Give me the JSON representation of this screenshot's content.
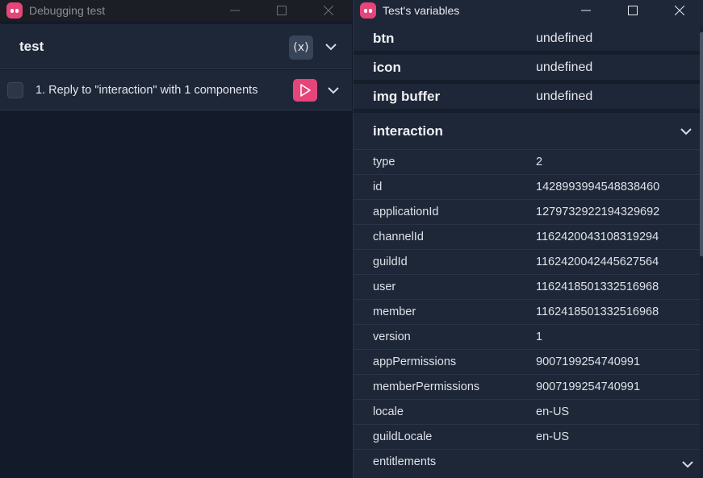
{
  "debug_window": {
    "title": "Debugging test",
    "test_name": "test",
    "variables_button_label": "(x)",
    "step": {
      "label": "1. Reply to \"interaction\" with 1 components"
    },
    "accent_color": "#e6457a"
  },
  "vars_window": {
    "title": "Test's variables",
    "top_vars": [
      {
        "name": "btn",
        "value": "undefined"
      },
      {
        "name": "icon",
        "value": "undefined"
      },
      {
        "name": "img buffer",
        "value": "undefined"
      }
    ],
    "group": {
      "name": "interaction",
      "fields": [
        {
          "name": "type",
          "value": "2"
        },
        {
          "name": "id",
          "value": "1428993994548838460"
        },
        {
          "name": "applicationId",
          "value": "1279732922194329692"
        },
        {
          "name": "channelId",
          "value": "1162420043108319294"
        },
        {
          "name": "guildId",
          "value": "1162420042445627564"
        },
        {
          "name": "user",
          "value": "1162418501332516968"
        },
        {
          "name": "member",
          "value": "1162418501332516968"
        },
        {
          "name": "version",
          "value": "1"
        },
        {
          "name": "appPermissions",
          "value": "9007199254740991"
        },
        {
          "name": "memberPermissions",
          "value": "9007199254740991"
        },
        {
          "name": "locale",
          "value": "en-US"
        },
        {
          "name": "guildLocale",
          "value": "en-US"
        }
      ],
      "partial_next": "entitlements"
    }
  }
}
